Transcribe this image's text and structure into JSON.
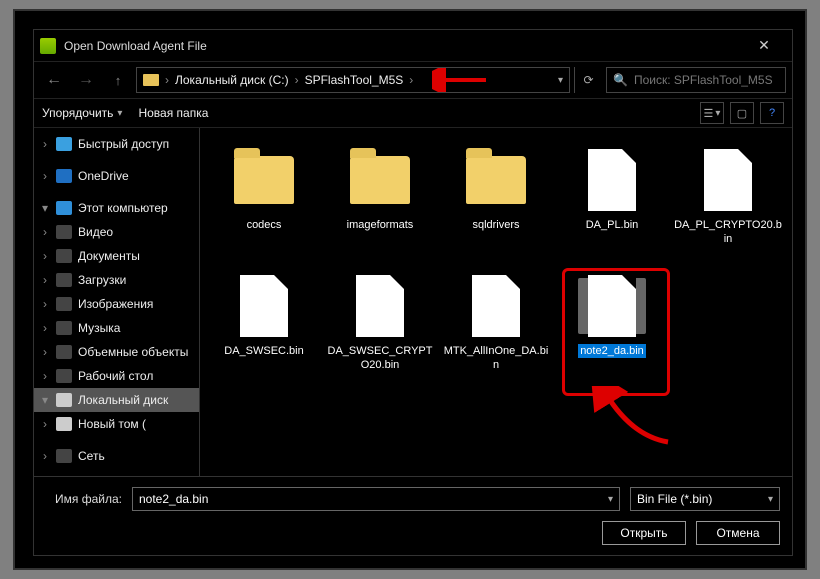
{
  "window": {
    "title": "Open Download Agent File"
  },
  "breadcrumb": {
    "segments": [
      "Локальный диск (C:)",
      "SPFlashTool_M5S"
    ]
  },
  "search": {
    "placeholder": "Поиск: SPFlashTool_M5S"
  },
  "cmdbar": {
    "organize": "Упорядочить",
    "newfolder": "Новая папка"
  },
  "sidebar": {
    "items": [
      {
        "kind": "item",
        "icon": "star",
        "label": "Быстрый доступ",
        "caret": ">"
      },
      {
        "kind": "spacer"
      },
      {
        "kind": "item",
        "icon": "cloud",
        "label": "OneDrive",
        "caret": ">"
      },
      {
        "kind": "spacer"
      },
      {
        "kind": "item",
        "icon": "pc",
        "label": "Этот компьютер",
        "caret": "v"
      },
      {
        "kind": "item",
        "icon": "video",
        "label": "Видео",
        "caret": ">"
      },
      {
        "kind": "item",
        "icon": "doc",
        "label": "Документы",
        "caret": ">"
      },
      {
        "kind": "item",
        "icon": "dl",
        "label": "Загрузки",
        "caret": ">"
      },
      {
        "kind": "item",
        "icon": "pic",
        "label": "Изображения",
        "caret": ">"
      },
      {
        "kind": "item",
        "icon": "music",
        "label": "Музыка",
        "caret": ">"
      },
      {
        "kind": "item",
        "icon": "obj",
        "label": "Объемные объекты",
        "caret": ">"
      },
      {
        "kind": "item",
        "icon": "desk",
        "label": "Рабочий стол",
        "caret": ">"
      },
      {
        "kind": "item",
        "icon": "disk",
        "label": "Локальный диск",
        "caret": "v",
        "selected": true
      },
      {
        "kind": "item",
        "icon": "disk",
        "label": "Новый том (",
        "caret": ">"
      },
      {
        "kind": "spacer"
      },
      {
        "kind": "item",
        "icon": "net",
        "label": "Сеть",
        "caret": ">"
      }
    ]
  },
  "files": {
    "row1": [
      {
        "type": "folder",
        "name": "codecs"
      },
      {
        "type": "folder",
        "name": "imageformats"
      },
      {
        "type": "folder",
        "name": "sqldrivers"
      },
      {
        "type": "file",
        "name": "DA_PL.bin"
      },
      {
        "type": "file",
        "name": "DA_PL_CRYPTO20.bin"
      }
    ],
    "row2": [
      {
        "type": "file",
        "name": "DA_SWSEC.bin"
      },
      {
        "type": "file",
        "name": "DA_SWSEC_CRYPTO20.bin"
      },
      {
        "type": "file",
        "name": "MTK_AllInOne_DA.bin"
      },
      {
        "type": "file",
        "name": "note2_da.bin",
        "selected": true
      }
    ]
  },
  "bottom": {
    "filename_label": "Имя файла:",
    "filename_value": "note2_da.bin",
    "filter": "Bin File (*.bin)",
    "open": "Открыть",
    "cancel": "Отмена"
  },
  "colors": {
    "folder": "#f2d06a",
    "selection": "#0078d7",
    "annotation": "#d00000"
  }
}
